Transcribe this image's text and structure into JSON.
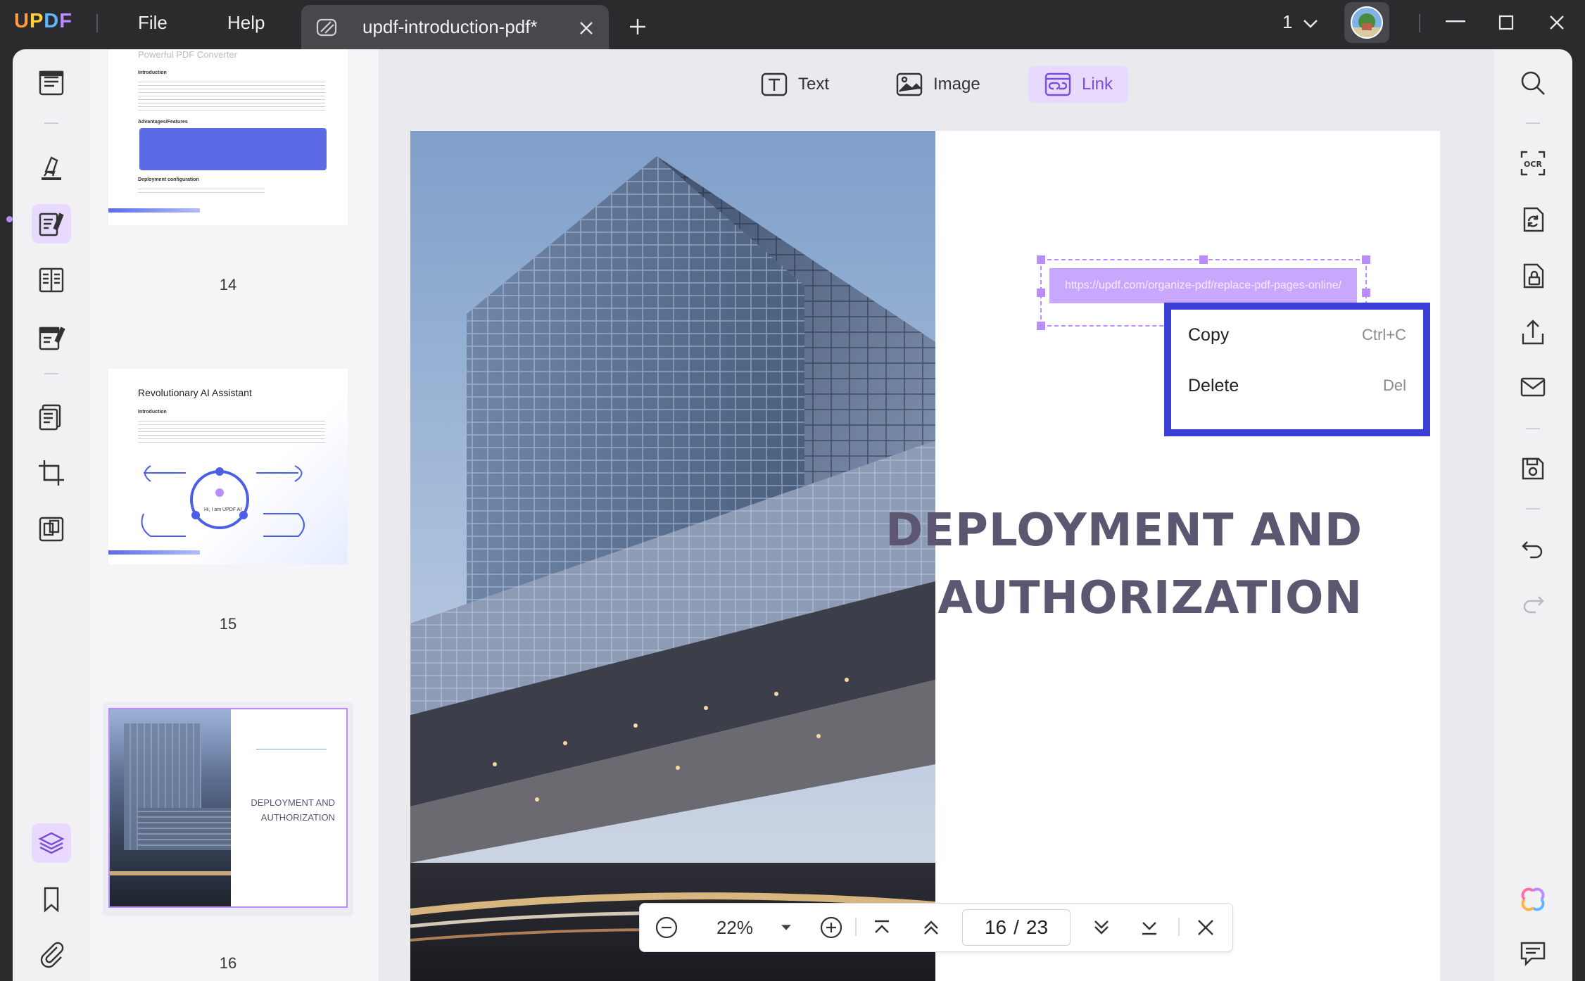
{
  "app": {
    "logo": [
      "U",
      "P",
      "D",
      "F"
    ],
    "menu": {
      "file": "File",
      "help": "Help"
    },
    "tab": {
      "title": "updf-introduction-pdf*"
    },
    "window_count": "1"
  },
  "thumbnails": [
    {
      "number": "14",
      "title": "Powerful PDF Converter",
      "section1": "Introduction",
      "section2": "Advantages/Features",
      "section3": "Deployment configuration"
    },
    {
      "number": "15",
      "title": "Revolutionary AI Assistant",
      "section1": "Introduction",
      "bubble": "Hi, I am UPDF AI"
    },
    {
      "number": "16",
      "line1": "DEPLOYMENT AND",
      "line2": "AUTHORIZATION"
    }
  ],
  "edit_toolbar": {
    "text": "Text",
    "image": "Image",
    "link": "Link"
  },
  "page": {
    "link_url": "https://updf.com/organize-pdf/replace-pdf-pages-online/",
    "heading_line1": "DEPLOYMENT AND",
    "heading_line2": "AUTHORIZATION"
  },
  "context_menu": {
    "copy": {
      "label": "Copy",
      "shortcut": "Ctrl+C"
    },
    "delete": {
      "label": "Delete",
      "shortcut": "Del"
    }
  },
  "nav": {
    "zoom": "22%",
    "current_page": "16",
    "separator": "/",
    "total_pages": "23"
  },
  "colors": {
    "accent": "#b98cff",
    "context_border": "#3c3fd6",
    "titlebar": "#2b2b2e"
  }
}
